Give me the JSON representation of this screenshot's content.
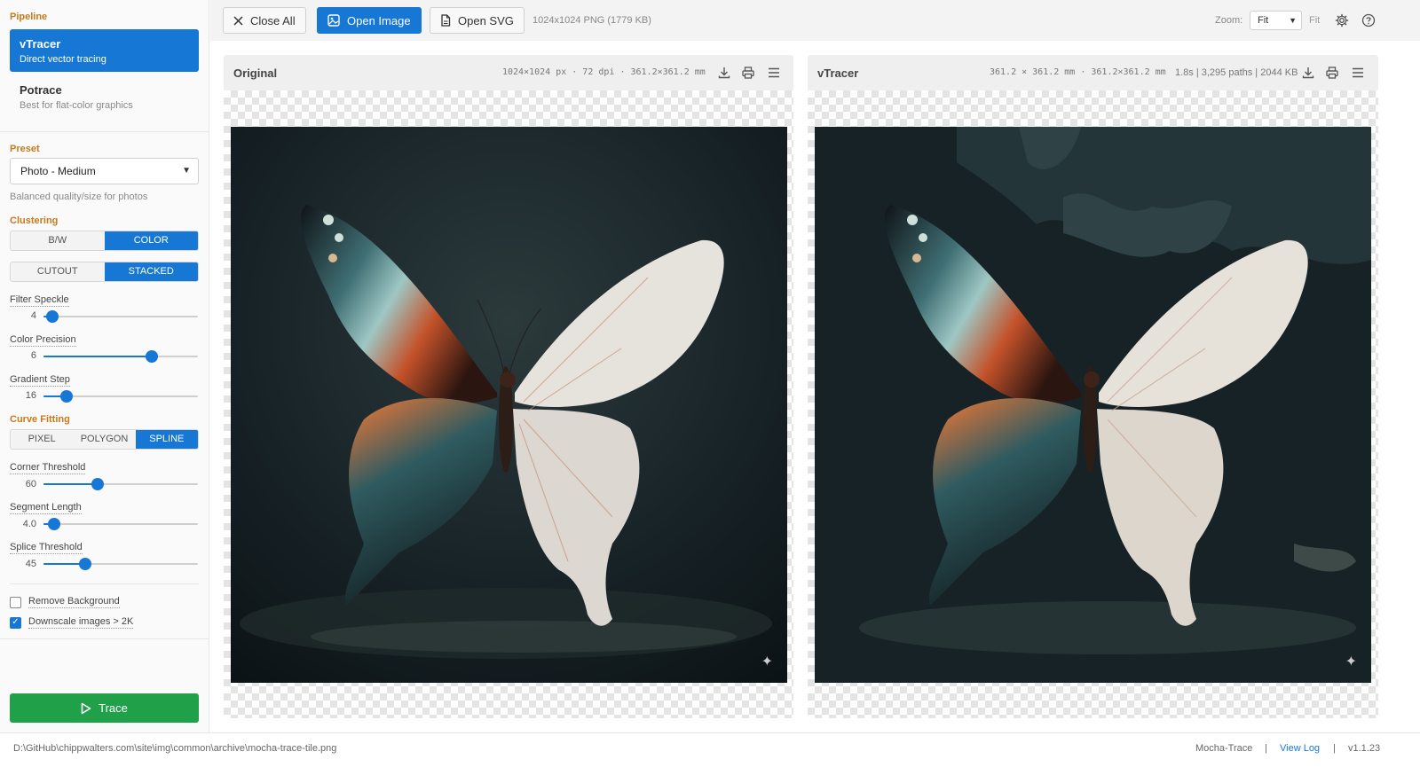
{
  "sidebar": {
    "pipeline_title": "Pipeline",
    "pipelines": [
      {
        "title": "vTracer",
        "subtitle": "Direct vector tracing",
        "active": true
      },
      {
        "title": "Potrace",
        "subtitle": "Best for flat-color graphics",
        "active": false
      }
    ],
    "preset_title": "Preset",
    "preset_value": "Photo - Medium",
    "preset_hint": "Balanced quality/size for photos",
    "clustering_title": "Clustering",
    "color_mode": {
      "options": [
        "B/W",
        "COLOR"
      ],
      "selected": "COLOR"
    },
    "hierarchy": {
      "options": [
        "CUTOUT",
        "STACKED"
      ],
      "selected": "STACKED"
    },
    "sliders1": [
      {
        "label": "Filter Speckle",
        "value": "4",
        "fraction": 0.06
      },
      {
        "label": "Color Precision",
        "value": "6",
        "fraction": 0.7
      },
      {
        "label": "Gradient Step",
        "value": "16",
        "fraction": 0.15
      }
    ],
    "curve_title": "Curve Fitting",
    "curve_mode": {
      "options": [
        "PIXEL",
        "POLYGON",
        "SPLINE"
      ],
      "selected": "SPLINE"
    },
    "sliders2": [
      {
        "label": "Corner Threshold",
        "value": "60",
        "fraction": 0.35
      },
      {
        "label": "Segment Length",
        "value": "4.0",
        "fraction": 0.07
      },
      {
        "label": "Splice Threshold",
        "value": "45",
        "fraction": 0.27
      }
    ],
    "checkboxes": [
      {
        "label": "Remove Background",
        "checked": false
      },
      {
        "label": "Downscale images > 2K",
        "checked": true
      }
    ],
    "trace_label": "Trace"
  },
  "toolbar": {
    "close_all": "Close All",
    "open_image": "Open Image",
    "open_svg": "Open SVG",
    "file_info": "1024x1024 PNG (1779 KB)",
    "zoom_label": "Zoom:",
    "zoom_value": "Fit",
    "fit_label": "Fit"
  },
  "panels": {
    "original": {
      "title": "Original",
      "info": "1024×1024 px · 72 dpi · 361.2×361.2 mm"
    },
    "traced": {
      "title": "vTracer",
      "info": "361.2 × 361.2 mm · 361.2×361.2 mm",
      "stats": "1.8s | 3,295 paths | 2044 KB"
    }
  },
  "status": {
    "path": "D:\\GitHub\\chippwalters.com\\site\\img\\common\\archive\\mocha-trace-tile.png",
    "app": "Mocha-Trace",
    "sep1": "|",
    "view_log": "View Log",
    "sep2": "|",
    "version": "v1.1.23"
  },
  "icons": [
    "close-icon",
    "image-icon",
    "file-icon",
    "gear-icon",
    "help-icon",
    "download-icon",
    "print-icon",
    "menu-icon",
    "play-icon",
    "sparkle-icon"
  ],
  "colors": {
    "accent": "#1677d4",
    "trace": "#21a04a",
    "section": "#c67a1b"
  }
}
